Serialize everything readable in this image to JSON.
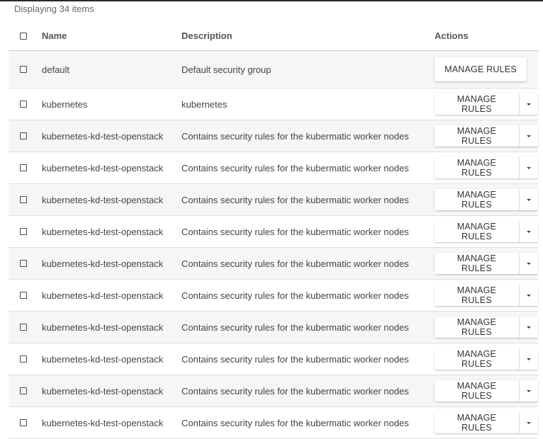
{
  "summary": "Displaying 34 items",
  "headers": {
    "name": "Name",
    "description": "Description",
    "actions": "Actions"
  },
  "action_label": "MANAGE RULES",
  "rows": [
    {
      "name": "default",
      "description": "Default security group"
    },
    {
      "name": "kubernetes",
      "description": "kubernetes"
    },
    {
      "name": "kubernetes-kd-test-openstack",
      "description": "Contains security rules for the kubermatic worker nodes"
    },
    {
      "name": "kubernetes-kd-test-openstack",
      "description": "Contains security rules for the kubermatic worker nodes"
    },
    {
      "name": "kubernetes-kd-test-openstack",
      "description": "Contains security rules for the kubermatic worker nodes"
    },
    {
      "name": "kubernetes-kd-test-openstack",
      "description": "Contains security rules for the kubermatic worker nodes"
    },
    {
      "name": "kubernetes-kd-test-openstack",
      "description": "Contains security rules for the kubermatic worker nodes"
    },
    {
      "name": "kubernetes-kd-test-openstack",
      "description": "Contains security rules for the kubermatic worker nodes"
    },
    {
      "name": "kubernetes-kd-test-openstack",
      "description": "Contains security rules for the kubermatic worker nodes"
    },
    {
      "name": "kubernetes-kd-test-openstack",
      "description": "Contains security rules for the kubermatic worker nodes"
    },
    {
      "name": "kubernetes-kd-test-openstack",
      "description": "Contains security rules for the kubermatic worker nodes"
    },
    {
      "name": "kubernetes-kd-test-openstack",
      "description": "Contains security rules for the kubermatic worker nodes"
    }
  ]
}
